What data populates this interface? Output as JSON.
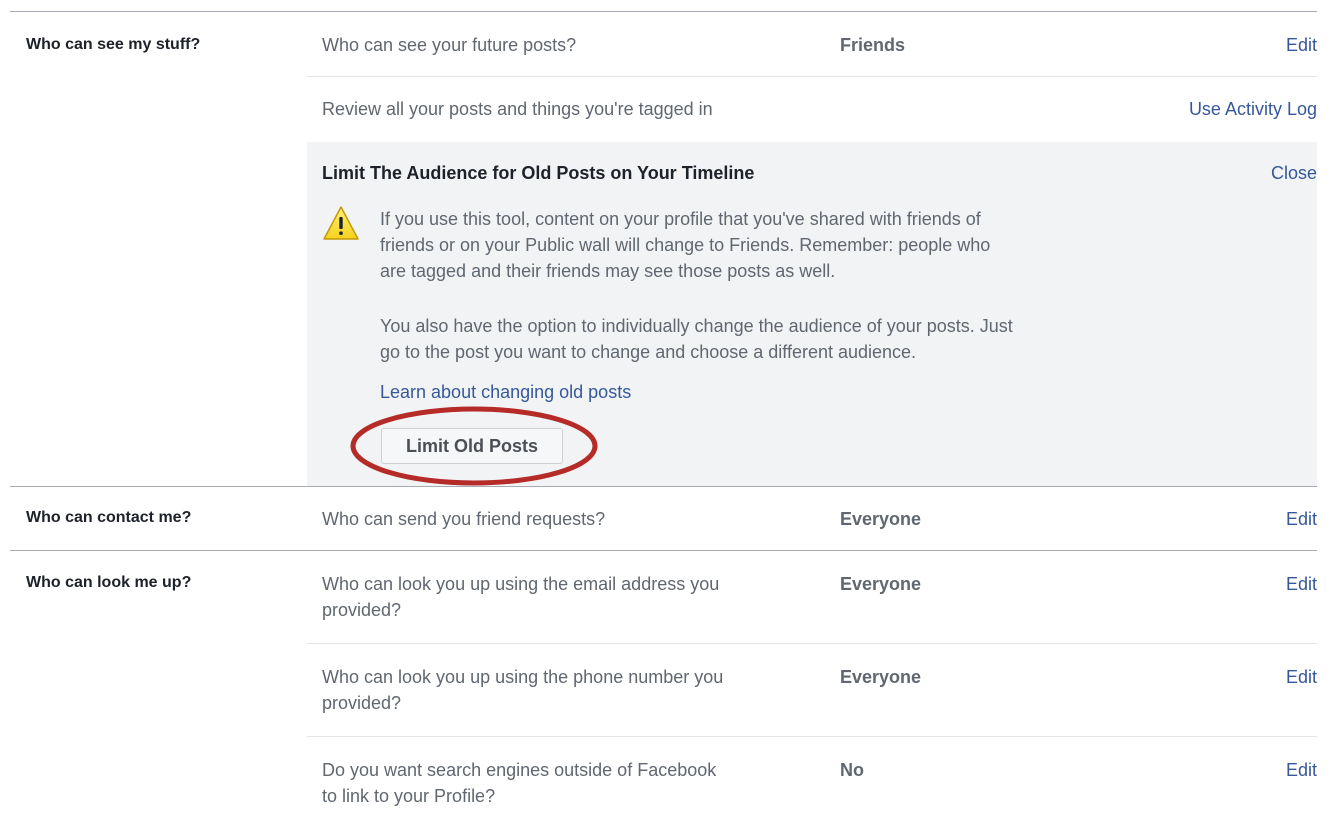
{
  "sections": {
    "stuff": {
      "label": "Who can see my stuff?",
      "future_posts": {
        "question": "Who can see your future posts?",
        "value": "Friends",
        "action": "Edit"
      },
      "review": {
        "question": "Review all your posts and things you're tagged in",
        "action": "Use Activity Log"
      },
      "limit_panel": {
        "title": "Limit The Audience for Old Posts on Your Timeline",
        "close_label": "Close",
        "warning_icon": "warning-triangle-icon",
        "warning_lines": [
          "If you use this tool, content on your profile that you've shared with friends of",
          "friends or on your Public wall will change to Friends. Remember: people who",
          "are tagged and their friends may see those posts as well."
        ],
        "option_lines": [
          "You also have the option to individually change the audience of your posts. Just",
          "go to the post you want to change and choose a different audience."
        ],
        "learn_link": "Learn about changing old posts",
        "button_label": "Limit Old Posts"
      }
    },
    "contact": {
      "label": "Who can contact me?",
      "friend_requests": {
        "question": "Who can send you friend requests?",
        "value": "Everyone",
        "action": "Edit"
      }
    },
    "lookup": {
      "label": "Who can look me up?",
      "email": {
        "question_lines": [
          "Who can look you up using the email address you",
          "provided?"
        ],
        "value": "Everyone",
        "action": "Edit"
      },
      "phone": {
        "question_lines": [
          "Who can look you up using the phone number you",
          "provided?"
        ],
        "value": "Everyone",
        "action": "Edit"
      },
      "search_engines": {
        "question_lines": [
          "Do you want search engines outside of Facebook",
          "to link to your Profile?"
        ],
        "value": "No",
        "action": "Edit"
      }
    }
  },
  "colors": {
    "link": "#365899",
    "annotation": "#b52b27",
    "panel_bg": "#f2f3f5"
  }
}
